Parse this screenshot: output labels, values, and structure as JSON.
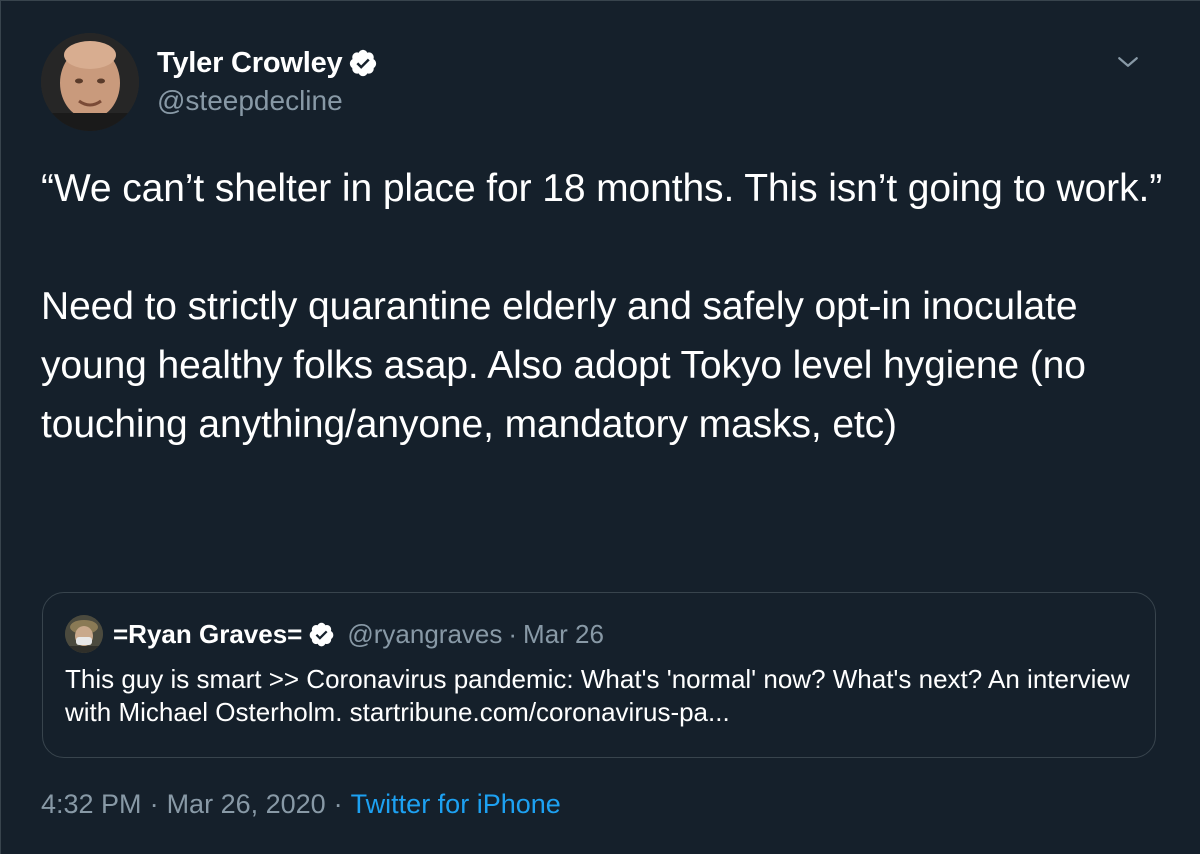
{
  "tweet": {
    "display_name": "Tyler Crowley",
    "handle": "@steepdecline",
    "text": "“We can’t shelter in place for 18 months. This isn’t going to work.”\n\nNeed to strictly quarantine elderly and safely opt-in inoculate young healthy folks asap. Also adopt Tokyo level hygiene (no touching anything/anyone, mandatory masks, etc)",
    "time": "4:32 PM",
    "date": "Mar 26, 2020",
    "separator": "·",
    "source": "Twitter for iPhone"
  },
  "quote": {
    "display_name": "=Ryan Graves=",
    "handle": "@ryangraves",
    "separator": "·",
    "date": "Mar 26",
    "text": "This guy is smart >> Coronavirus pandemic: What's 'normal' now? What's next? An interview with Michael Osterholm.  startribune.com/coronavirus-pa..."
  },
  "colors": {
    "background": "#15202b",
    "border": "#38444d",
    "secondary_text": "#8899a6",
    "link": "#1da1f2",
    "verified_badge": "#ffffff"
  },
  "icons": {
    "verified": "verified-badge-icon",
    "more": "chevron-down-icon"
  }
}
